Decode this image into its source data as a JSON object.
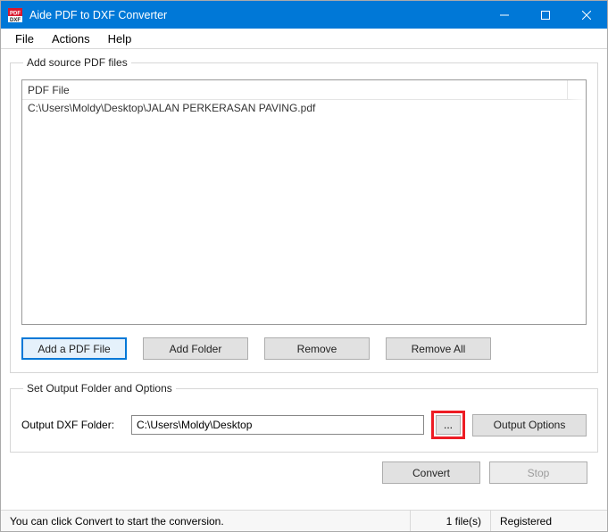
{
  "titlebar": {
    "title": "Aide PDF to DXF Converter"
  },
  "menu": {
    "file": "File",
    "actions": "Actions",
    "help": "Help"
  },
  "source": {
    "legend": "Add source PDF files",
    "column_header": "PDF File",
    "rows": [
      "C:\\Users\\Moldy\\Desktop\\JALAN PERKERASAN PAVING.pdf"
    ],
    "buttons": {
      "add_pdf": "Add a PDF File",
      "add_folder": "Add Folder",
      "remove": "Remove",
      "remove_all": "Remove All"
    }
  },
  "output": {
    "legend": "Set Output Folder and Options",
    "label": "Output DXF Folder:",
    "path": "C:\\Users\\Moldy\\Desktop",
    "browse": "...",
    "options": "Output Options"
  },
  "actions": {
    "convert": "Convert",
    "stop": "Stop"
  },
  "status": {
    "hint": "You can click Convert to start the conversion.",
    "files": "1 file(s)",
    "license": "Registered"
  }
}
